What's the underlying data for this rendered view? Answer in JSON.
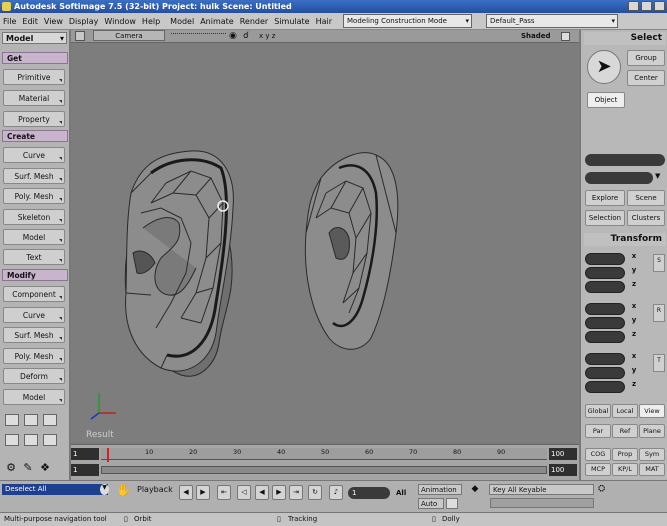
{
  "titlebar": {
    "text": "Autodesk Softimage 7.5 (32-bit)    Project: hulk    Scene: Untitled"
  },
  "menu": [
    "File",
    "Edit",
    "View",
    "Display",
    "Window",
    "Help",
    "Model",
    "Animate",
    "Render",
    "Simulate",
    "Hair"
  ],
  "layout_combo": "Modeling Construction Mode",
  "pass_combo": "Default_Pass",
  "left": {
    "mode": "Model",
    "sections": {
      "get": "Get",
      "create": "Create",
      "modify": "Modify"
    },
    "get_buttons": [
      "Primitive",
      "Material",
      "Property"
    ],
    "create_buttons": [
      "Curve",
      "Surf. Mesh",
      "Poly. Mesh",
      "Skeleton",
      "Model",
      "Text"
    ],
    "modify_buttons": [
      "Component",
      "Curve",
      "Surf. Mesh",
      "Poly. Mesh",
      "Deform",
      "Model"
    ]
  },
  "viewport": {
    "camera": "Camera",
    "shading": "Shaded",
    "axes_label": "Result"
  },
  "right": {
    "select_title": "Select",
    "group": "Group",
    "center": "Center",
    "object": "Object",
    "explore": "Explore",
    "scene": "Scene",
    "selection": "Selection",
    "clusters": "Clusters",
    "transform_title": "Transform",
    "axes": [
      "x",
      "y",
      "z"
    ],
    "side": [
      "S",
      "R",
      "T"
    ],
    "space_tabs": [
      "Global",
      "Local",
      "View"
    ],
    "ref_tabs": [
      "Par",
      "Ref",
      "Plane"
    ],
    "bottom_row1": [
      "COG",
      "Prop",
      "Sym"
    ],
    "bottom_row2": [
      "MCP",
      "KP/L",
      "MAT"
    ]
  },
  "timeline": {
    "start": "1",
    "end": "100",
    "ticks": [
      "10",
      "20",
      "30",
      "40",
      "50",
      "60",
      "70",
      "80",
      "90"
    ],
    "current": "1",
    "end2": "100"
  },
  "playback": {
    "selection_text": "Deselect All",
    "playback_label": "Playback",
    "frame_value": "1",
    "all_label": "All",
    "animation_label": "Animation",
    "auto_label": "Auto",
    "key_label": "Key All Keyable"
  },
  "status": {
    "hint": "Multi-purpose navigation tool",
    "orbit": "Orbit",
    "tracking": "Tracking",
    "dolly": "Dolly"
  },
  "colors": {
    "title_bar": "#2f5fb3",
    "section_header": "#c8b4cc",
    "viewport": "#7d7d7d",
    "timeline_marker": "#d02020"
  }
}
